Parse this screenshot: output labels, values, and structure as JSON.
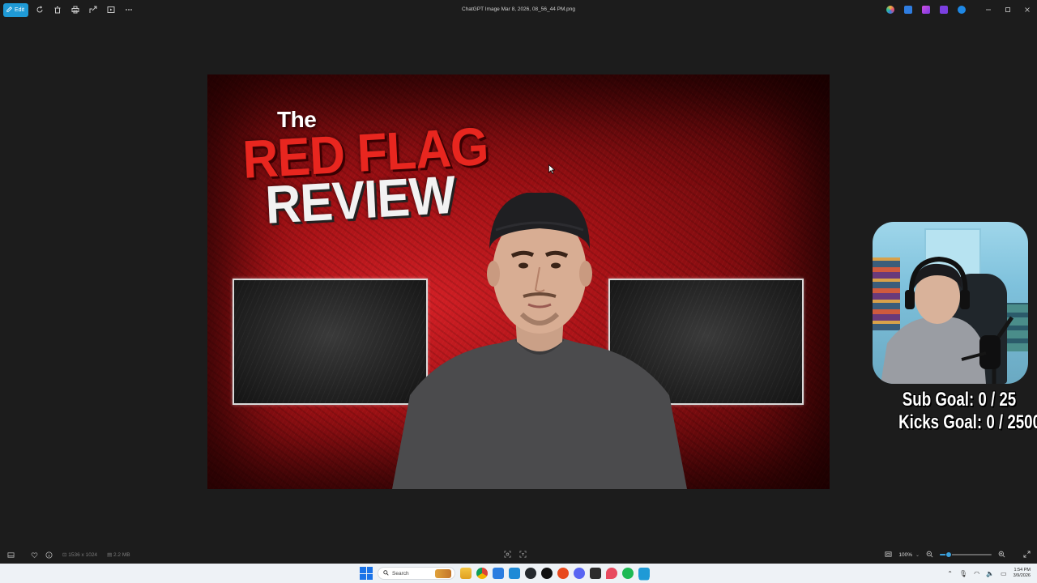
{
  "titlebar": {
    "edit_label": "Edit",
    "file_title": "ChatGPT Image Mar 8, 2026, 08_56_44 PM.png",
    "window_controls": [
      "minimize-icon",
      "maximize-icon",
      "close-icon"
    ]
  },
  "thumbnail": {
    "line1": "The",
    "line2": "RED FLAG",
    "line3": "REVIEW",
    "accent_red": "#e8261f"
  },
  "overlay": {
    "sub_goal": "Sub Goal:  0 / 25",
    "kicks_goal": "Kicks Goal:  0 / 2500"
  },
  "statusbar": {
    "dimensions": "1536 x 1024",
    "file_size": "2.2 MB",
    "zoom_label": "100%",
    "zoom_fraction": 0.17
  },
  "taskbar": {
    "search_placeholder": "Search",
    "clock_time": "1:54 PM",
    "clock_date": "3/9/2026",
    "accent": "#1a73e8"
  }
}
